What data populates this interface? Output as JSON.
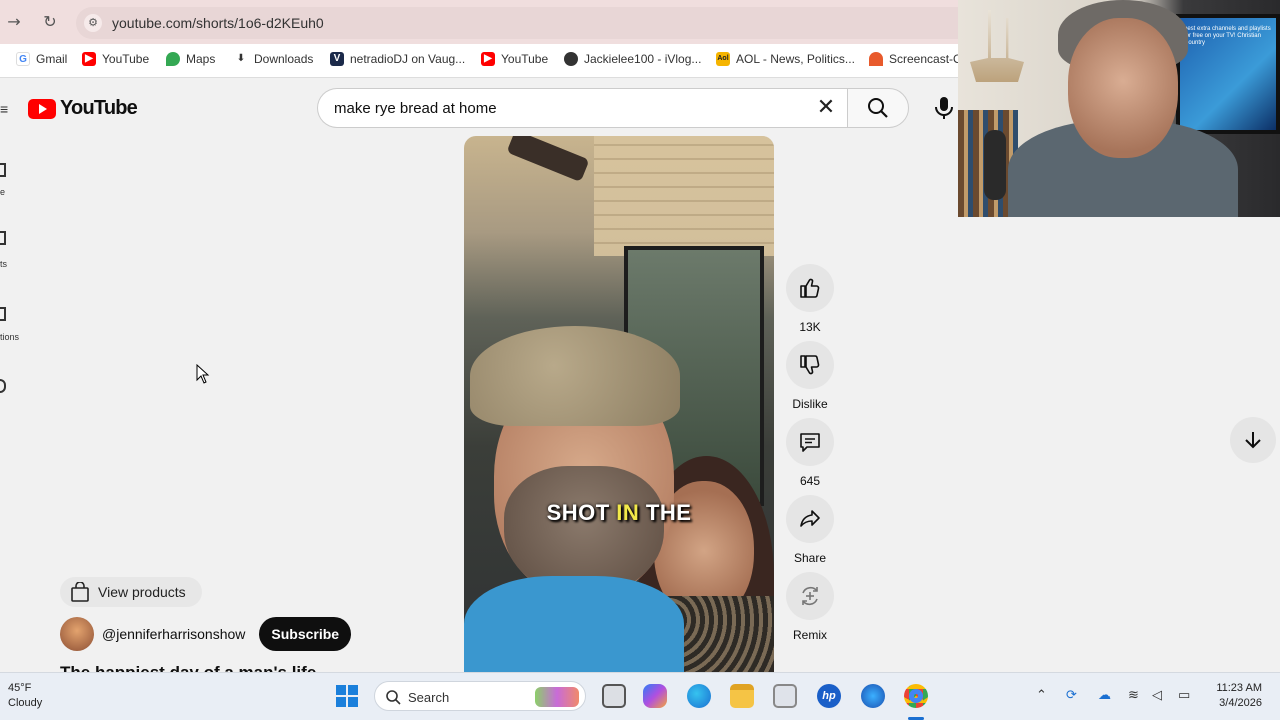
{
  "browser": {
    "url": "youtube.com/shorts/1o6-d2KEuh0",
    "bookmarks": [
      {
        "label": "Gmail",
        "icon": "google-icon"
      },
      {
        "label": "YouTube",
        "icon": "youtube-icon"
      },
      {
        "label": "Maps",
        "icon": "maps-icon"
      },
      {
        "label": "Downloads",
        "icon": "download-icon"
      },
      {
        "label": "netradioDJ on Vaug...",
        "icon": "vaughn-icon"
      },
      {
        "label": "YouTube",
        "icon": "youtube-icon"
      },
      {
        "label": "Jackielee100 - iVlog...",
        "icon": "globe-icon"
      },
      {
        "label": "AOL - News, Politics...",
        "icon": "aol-icon"
      },
      {
        "label": "Screencast-O",
        "icon": "screencast-icon"
      }
    ]
  },
  "youtube": {
    "logo_text": "YouTube",
    "search_query": "make rye bread at home"
  },
  "rail": {
    "labels": [
      "e",
      "ts",
      "tions",
      ""
    ]
  },
  "short": {
    "caption_before": "SHOT ",
    "caption_highlight": "IN",
    "caption_after": " THE",
    "actions": {
      "like_count": "13K",
      "dislike_label": "Dislike",
      "comment_count": "645",
      "share_label": "Share",
      "remix_label": "Remix"
    },
    "view_products_label": "View products",
    "channel_handle": "@jenniferharrisonshow",
    "subscribe_label": "Subscribe",
    "title": "The happiest day of a man's life"
  },
  "webcam": {
    "tv_text": "best extra channels and playlists for free on your TV! Christian Country"
  },
  "taskbar": {
    "temp": "45°F",
    "condition": "Cloudy",
    "search_label": "Search",
    "time": "11:23 AM",
    "date": "3/4/2026"
  },
  "colors": {
    "youtube_red": "#ff0000",
    "caption_highlight": "#f2e94a",
    "subscribe_bg": "#0f0f0f"
  }
}
